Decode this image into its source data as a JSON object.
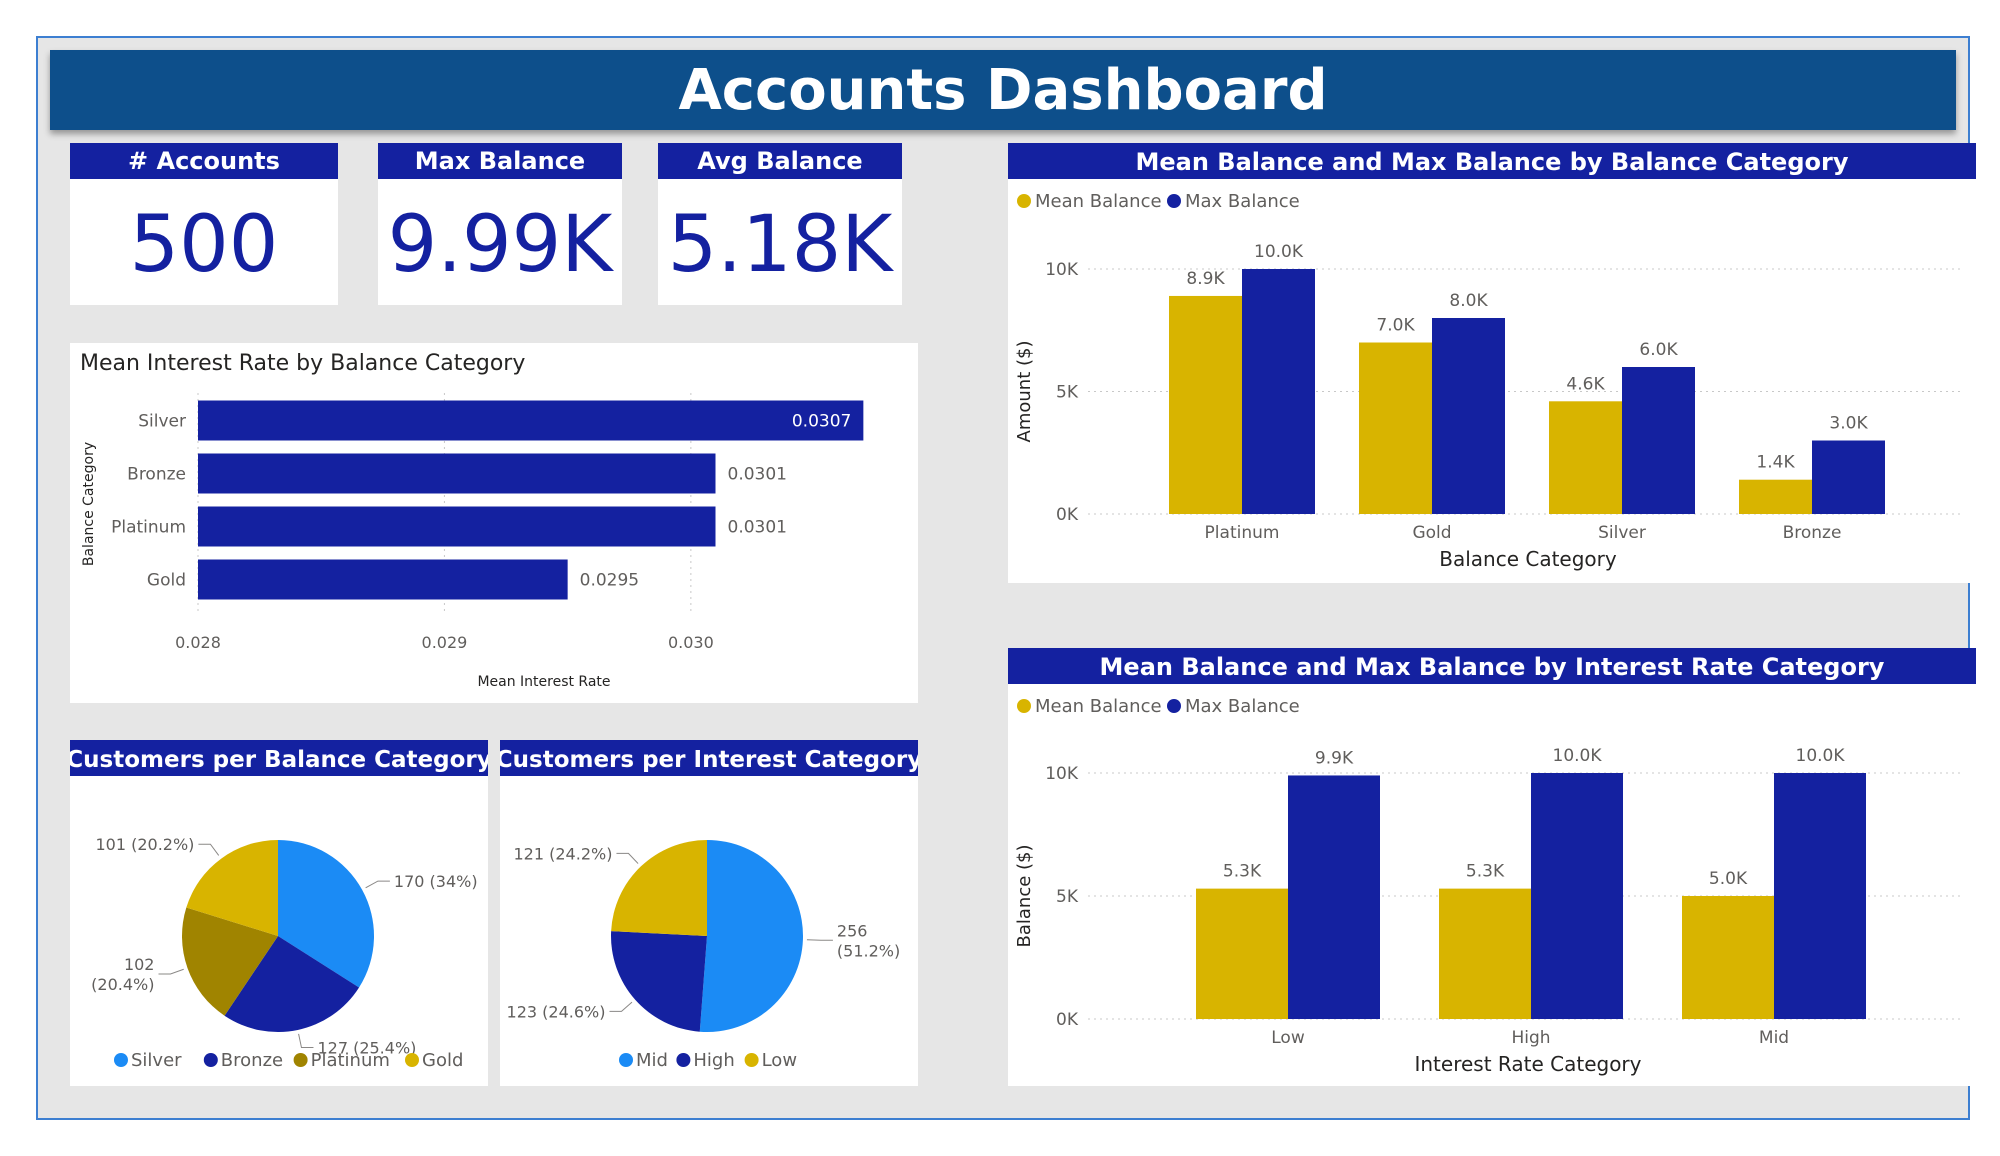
{
  "dashboard": {
    "title": "Accounts Dashboard"
  },
  "colors": {
    "gold": "#d8b400",
    "navy": "#1421a0",
    "light_blue": "#1b8bf5",
    "olive": "#a08400",
    "banner": "#0d4f8b"
  },
  "kpis": [
    {
      "label": "# Accounts",
      "value": "500"
    },
    {
      "label": "Max Balance",
      "value": "9.99K"
    },
    {
      "label": "Avg Balance",
      "value": "5.18K"
    }
  ],
  "chart_data": [
    {
      "id": "interest-rate-bar",
      "type": "bar",
      "orientation": "horizontal",
      "title": "Mean Interest Rate by Balance Category",
      "xlabel": "Mean Interest Rate",
      "ylabel": "Balance Category",
      "categories": [
        "Silver",
        "Bronze",
        "Platinum",
        "Gold"
      ],
      "values": [
        0.0307,
        0.0301,
        0.0301,
        0.0295
      ],
      "data_labels": [
        "0.0307",
        "0.0301",
        "0.0301",
        "0.0295"
      ],
      "xlim": [
        0.028,
        0.0308
      ],
      "xticks": [
        0.028,
        0.029,
        0.03
      ],
      "xtick_labels": [
        "0.028",
        "0.029",
        "0.030"
      ],
      "grid": true
    },
    {
      "id": "balance-category-bar",
      "type": "bar",
      "title": "Mean Balance and Max Balance by Balance Category",
      "xlabel": "Balance Category",
      "ylabel": "Amount ($)",
      "categories": [
        "Platinum",
        "Gold",
        "Silver",
        "Bronze"
      ],
      "series": [
        {
          "name": "Mean Balance",
          "values": [
            8900,
            7000,
            4600,
            1400
          ],
          "labels": [
            "8.9K",
            "7.0K",
            "4.6K",
            "1.4K"
          ]
        },
        {
          "name": "Max Balance",
          "values": [
            10000,
            8000,
            6000,
            3000
          ],
          "labels": [
            "10.0K",
            "8.0K",
            "6.0K",
            "3.0K"
          ]
        }
      ],
      "ylim": [
        0,
        10000
      ],
      "yticks": [
        0,
        5000,
        10000
      ],
      "ytick_labels": [
        "0K",
        "5K",
        "10K"
      ],
      "legend": "top-left",
      "grid": true
    },
    {
      "id": "interest-category-bar",
      "type": "bar",
      "title": "Mean Balance and Max Balance by Interest Rate Category",
      "xlabel": "Interest Rate Category",
      "ylabel": "Balance ($)",
      "categories": [
        "Low",
        "High",
        "Mid"
      ],
      "series": [
        {
          "name": "Mean Balance",
          "values": [
            5300,
            5300,
            5000
          ],
          "labels": [
            "5.3K",
            "5.3K",
            "5.0K"
          ]
        },
        {
          "name": "Max Balance",
          "values": [
            9900,
            10000,
            10000
          ],
          "labels": [
            "9.9K",
            "10.0K",
            "10.0K"
          ]
        }
      ],
      "ylim": [
        0,
        10000
      ],
      "yticks": [
        0,
        5000,
        10000
      ],
      "ytick_labels": [
        "0K",
        "5K",
        "10K"
      ],
      "legend": "top-left",
      "grid": true
    },
    {
      "id": "balance-pie",
      "type": "pie",
      "title": "Customers per Balance Category",
      "categories": [
        "Silver",
        "Bronze",
        "Platinum",
        "Gold"
      ],
      "values": [
        170,
        127,
        102,
        101
      ],
      "data_labels": [
        "170 (34%)",
        "127 (25.4%)",
        "102 (20.4%)",
        "101 (20.2%)"
      ],
      "legend": "bottom"
    },
    {
      "id": "interest-pie",
      "type": "pie",
      "title": "Customers per Interest Category",
      "categories": [
        "Mid",
        "High",
        "Low"
      ],
      "values": [
        256,
        123,
        121
      ],
      "data_labels": [
        "256 (51.2%)",
        "123 (24.6%)",
        "121 (24.2%)"
      ],
      "legend": "bottom"
    }
  ]
}
